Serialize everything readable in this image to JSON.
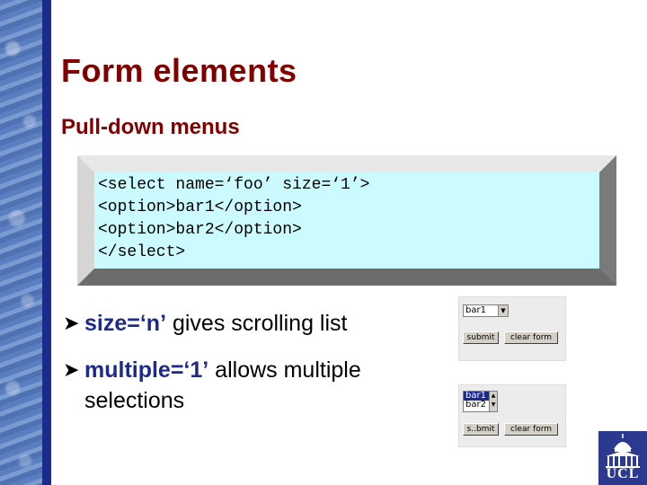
{
  "slide": {
    "title": "Form elements",
    "subtitle": "Pull-down menus"
  },
  "code": {
    "lines": [
      "<select name=‘foo’ size=‘1’>",
      "<option>bar1</option>",
      "<option>bar2</option>",
      "</select>"
    ]
  },
  "bullets": [
    {
      "code": "size=‘n’",
      "text": " gives scrolling list"
    },
    {
      "code": "multiple=‘1’",
      "text": " allows multiple selections"
    }
  ],
  "example1": {
    "select_value": "bar1",
    "submit_label": "submit",
    "clear_label": "clear form"
  },
  "example2": {
    "options": [
      "bar1",
      "bar2"
    ],
    "submit_label": "s..bmit",
    "clear_label": "clear form"
  },
  "logo": {
    "text": "UCL"
  },
  "colors": {
    "title": "#800000",
    "code_background": "#ccfbff",
    "accent": "#1b2a8c"
  }
}
